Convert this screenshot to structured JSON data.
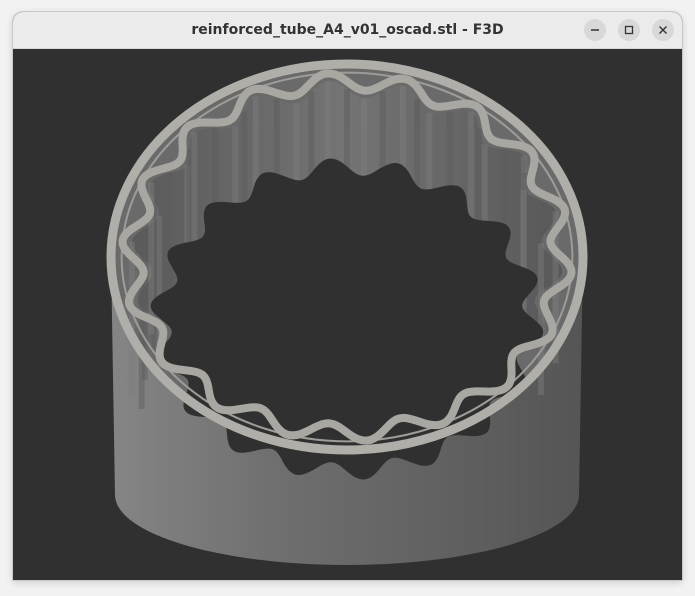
{
  "window": {
    "title": "reinforced_tube_A4_v01_oscad.stl - F3D"
  },
  "colors": {
    "background": "#303030",
    "model_outer": "#6e6e6e",
    "model_rim": "#b0aea8",
    "titlebar": "#ebebeb"
  },
  "icons": {
    "minimize": "minimize-icon",
    "maximize": "maximize-icon",
    "close": "close-icon"
  }
}
